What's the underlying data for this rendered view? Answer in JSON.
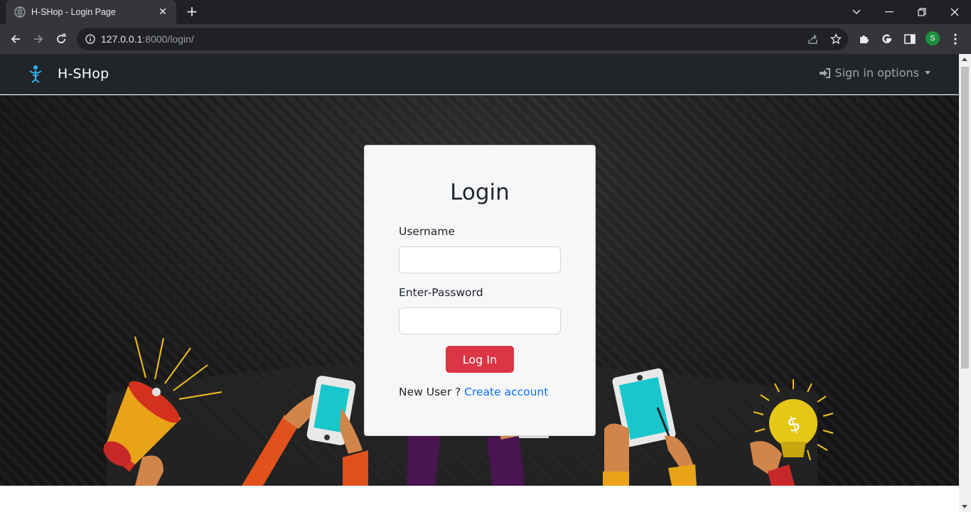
{
  "browser": {
    "tab_title": "H-SHop - Login Page",
    "url_host": "127.0.0.1",
    "url_path": ":8000/login/",
    "profile_initial": "S"
  },
  "navbar": {
    "brand": "H-SHop",
    "signin_label": "Sign in options"
  },
  "login": {
    "heading": "Login",
    "username_label": "Username",
    "username_value": "",
    "password_label": "Enter-Password",
    "password_value": "",
    "submit_label": "Log In",
    "new_user_text": "New User ?",
    "create_account_label": "Create account"
  },
  "colors": {
    "navbar_bg": "#212529",
    "primary_button": "#dc3545",
    "link": "#0d6efd",
    "card_bg": "#f6f7f9"
  }
}
